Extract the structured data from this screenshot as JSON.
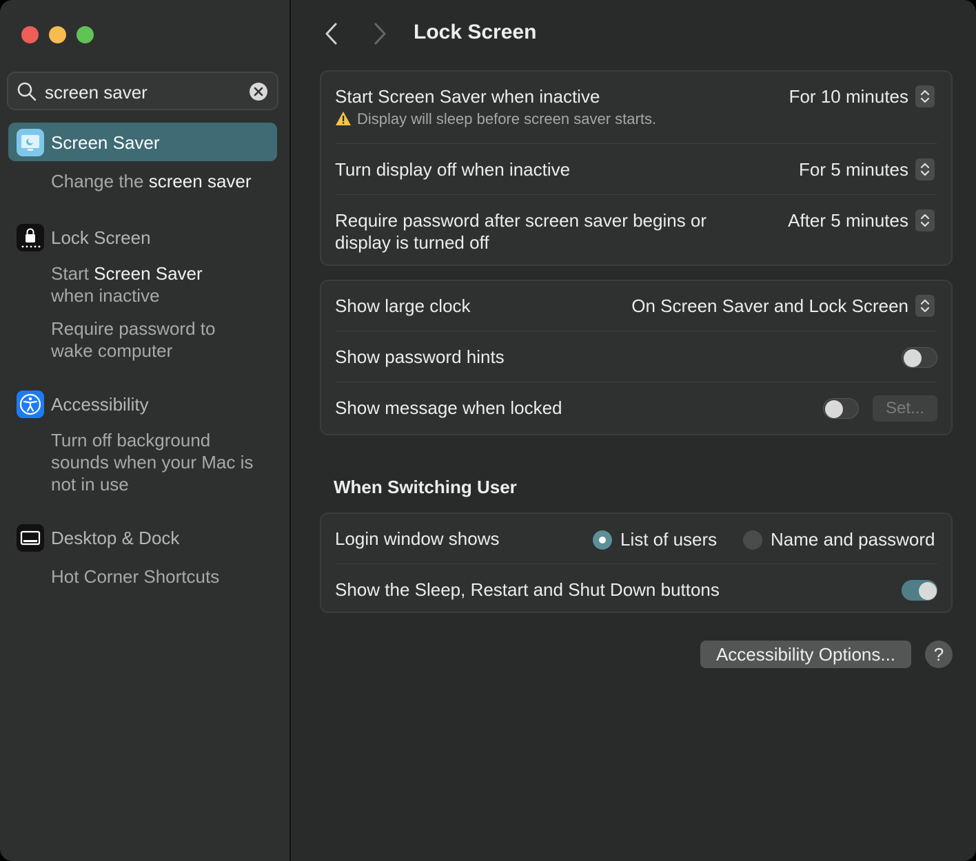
{
  "search": {
    "value": "screen saver"
  },
  "sidebar": {
    "screen_saver": {
      "title": "Screen Saver",
      "sub_prefix": "Change the",
      "sub_highlight": "screen saver"
    },
    "lock_screen": {
      "title": "Lock Screen",
      "sub1_prefix": "Start",
      "sub1_highlight": "Screen Saver",
      "sub1_line2": "when inactive",
      "sub2_line1": "Require password to",
      "sub2_line2": "wake computer"
    },
    "accessibility": {
      "title": "Accessibility",
      "sub_line1": "Turn off background",
      "sub_line2": "sounds when your Mac is",
      "sub_line3": "not in use"
    },
    "desktop_dock": {
      "title": "Desktop & Dock",
      "sub": "Hot Corner Shortcuts"
    }
  },
  "main": {
    "title": "Lock Screen",
    "group1": {
      "start_saver_label": "Start Screen Saver when inactive",
      "start_saver_value": "For 10 minutes",
      "warning": "Display will sleep before screen saver starts.",
      "display_off_label": "Turn display off when inactive",
      "display_off_value": "For 5 minutes",
      "password_label_line1": "Require password after screen saver begins or",
      "password_label_line2": "display is turned off",
      "password_value": "After 5 minutes"
    },
    "group2": {
      "large_clock_label": "Show large clock",
      "large_clock_value": "On Screen Saver and Lock Screen",
      "password_hints_label": "Show password hints",
      "password_hints_on": false,
      "message_label": "Show message when locked",
      "message_on": false,
      "set_button": "Set..."
    },
    "switching_heading": "When Switching User",
    "group3": {
      "login_label": "Login window shows",
      "option_list": "List of users",
      "option_name": "Name and password",
      "selected": "List of users",
      "sleep_buttons_label": "Show the Sleep, Restart and Shut Down buttons",
      "sleep_buttons_on": true
    },
    "accessibility_button": "Accessibility Options...",
    "help_button": "?"
  },
  "colors": {
    "accent": "#3e6b74",
    "toggle_on": "#4e7f88"
  }
}
